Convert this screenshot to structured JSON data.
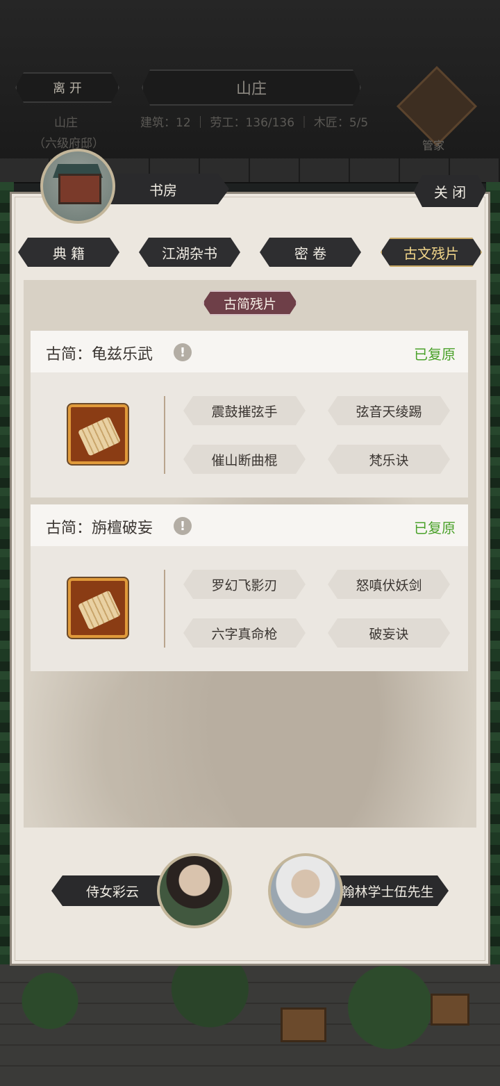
{
  "topbar": {
    "leave_label": "离 开",
    "title": "山庄",
    "location_name": "山庄",
    "location_level": "（六级府邸）",
    "stats": "建筑：12 ｜ 劳工：136/136 ｜ 木匠：5/5",
    "steward_label": "管家"
  },
  "panel": {
    "room_title": "书房",
    "close_label": "关 闭",
    "tabs": [
      "典 籍",
      "江湖杂书",
      "密 卷",
      "古文残片"
    ],
    "active_tab": "古文残片",
    "section_title": "古简残片"
  },
  "cards": [
    {
      "name": "古简：龟兹乐武",
      "status": "已复原",
      "skills": [
        "震鼓摧弦手",
        "弦音天绫踢",
        "催山断曲棍",
        "梵乐诀"
      ]
    },
    {
      "name": "古简：旃檀破妄",
      "status": "已复原",
      "skills": [
        "罗幻飞影刃",
        "怒嗔伏妖剑",
        "六字真命枪",
        "破妄诀"
      ]
    }
  ],
  "npcs": {
    "left": "侍女彩云",
    "right": "翰林学士伍先生"
  },
  "colors": {
    "status_green": "#4aa12a",
    "section_maroon": "#6e3f48",
    "active_tab_gold": "#f2d68a"
  }
}
